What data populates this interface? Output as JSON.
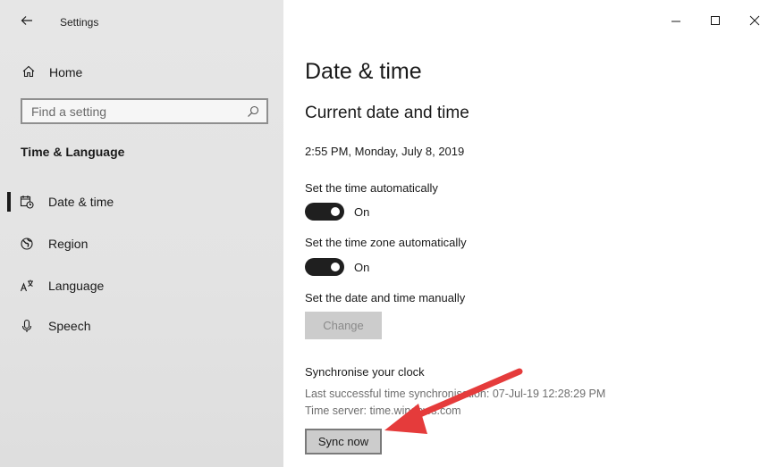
{
  "window": {
    "title": "Settings"
  },
  "sidebar": {
    "home_label": "Home",
    "search_placeholder": "Find a setting",
    "section_title": "Time & Language",
    "items": [
      {
        "label": "Date & time",
        "icon": "calendar-clock-icon",
        "selected": true
      },
      {
        "label": "Region",
        "icon": "globe-icon",
        "selected": false
      },
      {
        "label": "Language",
        "icon": "language-icon",
        "selected": false
      },
      {
        "label": "Speech",
        "icon": "microphone-icon",
        "selected": false
      }
    ]
  },
  "main": {
    "page_title": "Date & time",
    "current_section_title": "Current date and time",
    "current_datetime": "2:55 PM, Monday, July 8, 2019",
    "auto_time": {
      "label": "Set the time automatically",
      "state": "On"
    },
    "auto_timezone": {
      "label": "Set the time zone automatically",
      "state": "On"
    },
    "manual": {
      "label": "Set the date and time manually",
      "button": "Change"
    },
    "sync": {
      "title": "Synchronise your clock",
      "last_sync": "Last successful time synchronisation: 07-Jul-19 12:28:29 PM",
      "server": "Time server: time.windows.com",
      "button": "Sync now"
    }
  },
  "colors": {
    "sidebar_bg": "#e4e4e4",
    "toggle_on": "#1f1f1f",
    "annotation_arrow": "#e53b3b"
  }
}
